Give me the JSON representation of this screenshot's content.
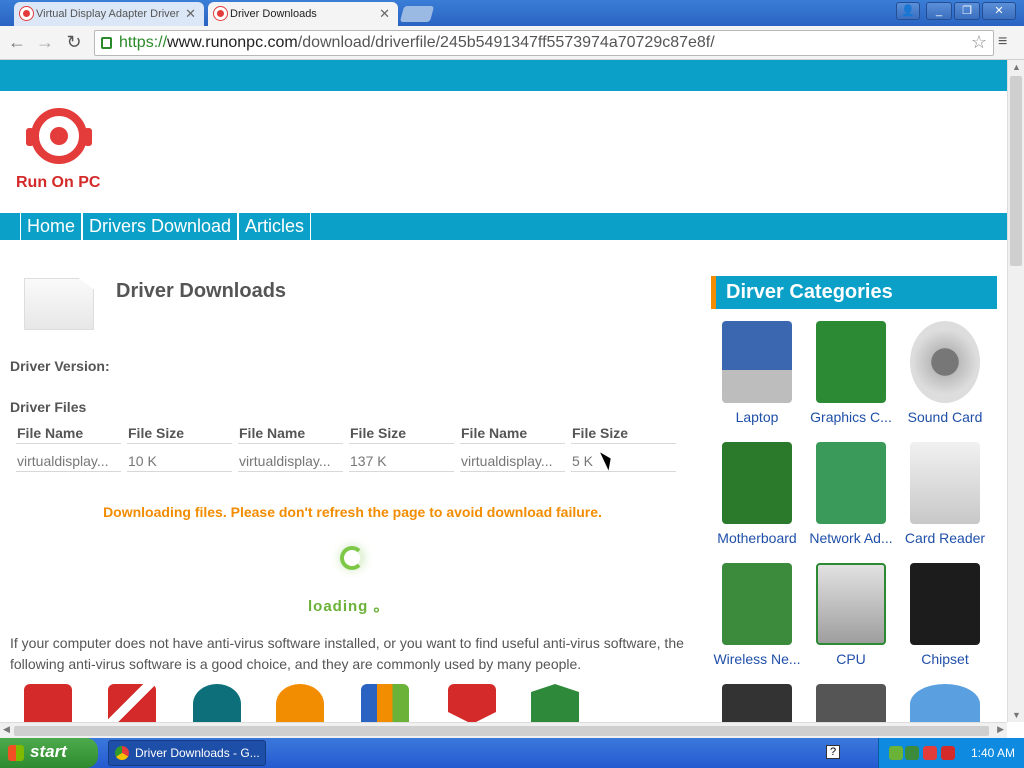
{
  "browser": {
    "tabs": [
      {
        "title": "Virtual Display Adapter Driver"
      },
      {
        "title": "Driver Downloads"
      }
    ],
    "url": {
      "scheme": "https://",
      "host": "www.runonpc.com",
      "path": "/download/driverfile/245b5491347ff5573974a70729c87e8f/"
    }
  },
  "site": {
    "logo_text": "Run On PC",
    "nav": [
      "Home",
      "Drivers Download",
      "Articles"
    ]
  },
  "main": {
    "title": "Driver Downloads",
    "driver_version_label": "Driver Version:",
    "driver_files_label": "Driver Files",
    "table": {
      "headers": [
        "File Name",
        "File Size",
        "File Name",
        "File Size",
        "File Name",
        "File Size"
      ],
      "row": [
        "virtualdisplay...",
        "10 K",
        "virtualdisplay...",
        "137 K",
        "virtualdisplay...",
        "5 K"
      ]
    },
    "download_message": "Downloading files. Please don't refresh the page to avoid download failure.",
    "loading_text": "loading 。",
    "antivirus_paragraph": "If your computer does not have anti-virus software installed, or you want to find useful anti-virus software, the following anti-virus software is a good choice, and they are commonly used by many people."
  },
  "sidebar": {
    "header": "Dirver Categories",
    "categories": [
      "Laptop",
      "Graphics C...",
      "Sound Card",
      "Motherboard",
      "Network Ad...",
      "Card Reader",
      "Wireless Ne...",
      "CPU",
      "Chipset"
    ]
  },
  "taskbar": {
    "start_label": "start",
    "task_item": "Driver Downloads - G...",
    "clock": "1:40 AM"
  }
}
